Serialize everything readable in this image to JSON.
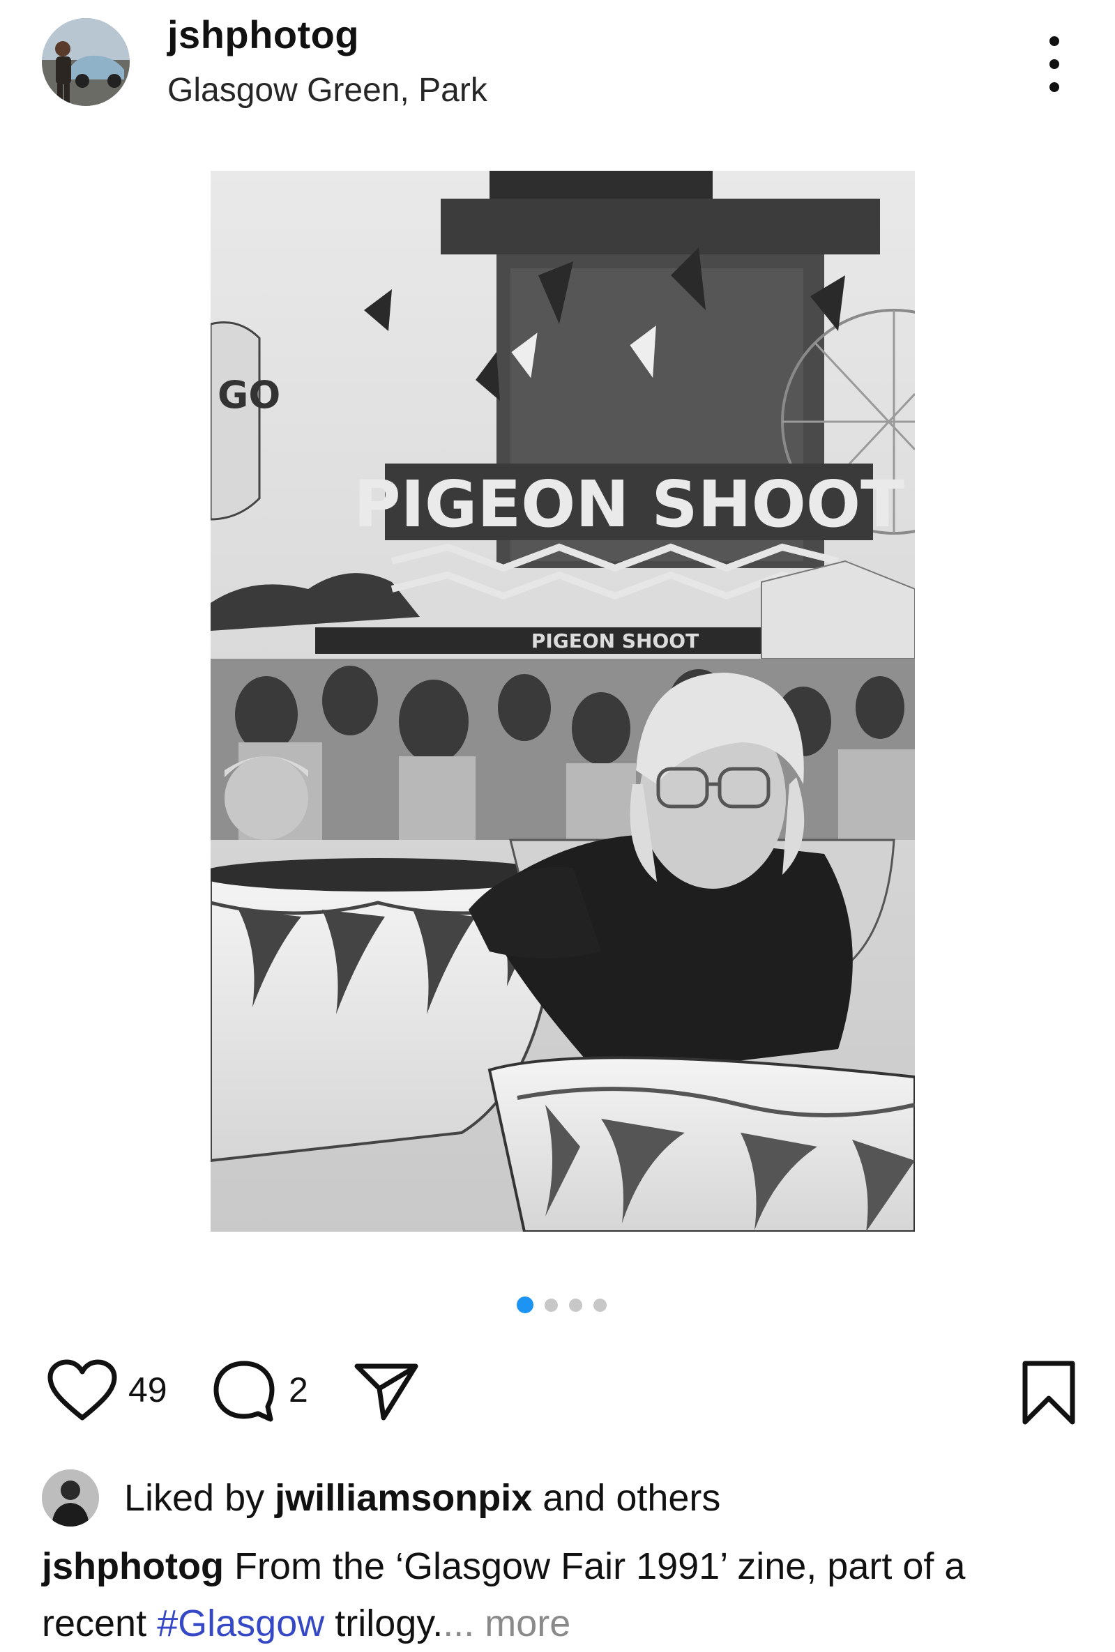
{
  "post": {
    "username": "jshphotog",
    "location": "Glasgow Green, Park",
    "more_icon": "more-vertical-icon",
    "photo": {
      "sign_main": "PIGEON SHOOT",
      "sign_small": "PIGEON SHOOT",
      "sign_left": "GO"
    },
    "carousel": {
      "total": 4,
      "active_index": 0,
      "active_color": "#1d93f3",
      "inactive_color": "#c7c7c7"
    },
    "actions": {
      "like_icon": "heart-icon",
      "like_count": "49",
      "comment_icon": "comment-icon",
      "comment_count": "2",
      "share_icon": "send-icon",
      "save_icon": "bookmark-icon"
    },
    "likes": {
      "prefix": "Liked by ",
      "user": "jwilliamsonpix",
      "suffix": " and others"
    },
    "caption": {
      "user": "jshphotog",
      "text_before": " From the ‘Glasgow Fair 1991’ zine, part of a recent ",
      "hashtag": "#Glasgow",
      "text_after": " trilogy.",
      "more": "... more",
      "hashtag_color": "#3548c6"
    }
  }
}
